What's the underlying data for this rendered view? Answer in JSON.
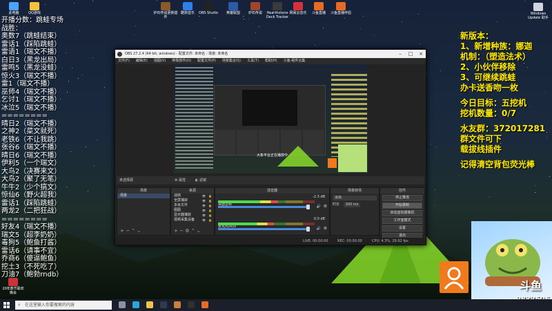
{
  "desktop": {
    "icons": [
      {
        "label": "此电脑",
        "color": "#4aa3ff"
      },
      {
        "label": "QQ游戏",
        "color": "#f5c33b"
      },
      {
        "label": "炉石传说更新插件",
        "color": "#8a5a2b"
      },
      {
        "label": "酷狗音乐",
        "color": "#2e7fe8"
      },
      {
        "label": "OBS Studio",
        "color": "#222222"
      },
      {
        "label": "英雄联盟",
        "color": "#2b5aa8"
      },
      {
        "label": "炉石传说",
        "color": "#a0442c"
      },
      {
        "label": "Hearthstone Deck Tracker",
        "color": "#3a3a3a"
      },
      {
        "label": "网易云音乐",
        "color": "#d8303a"
      },
      {
        "label": "斗鱼直播",
        "color": "#e86a25"
      },
      {
        "label": "斗鱼直播伴侣",
        "color": "#e86a25"
      },
      {
        "label": "Windows Update 助手",
        "color": "#cfd6e0"
      }
    ],
    "bottom_icon_label": "20年春节联欢晚会"
  },
  "left_overlay": {
    "header": "开播分数：跳蛙专场",
    "lines": [
      "战胜：",
      "奥数7（跳蛙结束）",
      "雷话1（踩陷跳蛙）",
      "雷语1（瑞文不播）",
      "白日3（黑龙出局）",
      "雷鸣5（黑龙没蛙）",
      "惊火3（瑞文不播）",
      "雷1（瑞文不播）",
      "巫师4（瑞文不播）",
      "乞讨1（瑞文不播）",
      "冰泣5（瑞文不播）",
      "========",
      "晴日2（瑞文不播）",
      "之神2（菜文就死）",
      "老铁6（不让我跳）",
      "张谷6（瑞文不播）",
      "晴日6（瑞文不播）",
      "伊利5（一个瑞文）",
      "大鸟2（决赛来文）",
      "大鸟2（聚了无笔）",
      "牛牛2（少个搞文）",
      "惊仙6（野火超我）",
      "雷话1（踩陷跳蛙）",
      "两龙2（二把狂战）",
      "========",
      "好友4（瑞文不播）",
      "瑞文5（超李奶奶）",
      "毒狗5（鲍鱼打酱）",
      "雷话6（请事不宜）",
      "乔商6（傻逼鲍鱼）",
      "挖土3（不死吃了）",
      "刀油7（鲍勃rndb）"
    ]
  },
  "right_overlay": {
    "lines": [
      "新版本：",
      "1、新增种族：娜迦",
      "机制：（塑造法术）",
      "2、小伙伴移除",
      "3、可继续跳蛙",
      "办卡送香吻一枚",
      "",
      "今日目标：五挖机",
      "挖机数量：0/7",
      "",
      "水友群：372017281",
      "群文件可下",
      "载拔线插件",
      "",
      "记得清空背包荧光棒"
    ]
  },
  "obs": {
    "title": "OBS 27.2.4 (64-bit, windows) - 配置文件: 未命名 - 场景: 未命名",
    "menu": [
      "文件(F)",
      "编辑(E)",
      "视图(V)",
      "停靠部件(D)",
      "配置文件(P)",
      "场景集合(S)",
      "工具(T)",
      "帮助(H)",
      "斗鱼-组件合集"
    ],
    "preview_caption": "大象平台正在播放中",
    "scene_label": "未选择源",
    "tabs": [
      "属性",
      "滤镜"
    ],
    "docks": {
      "scenes": {
        "title": "场景",
        "items": [
          "场景"
        ]
      },
      "sources": {
        "title": "来源",
        "items": [
          "战绩",
          "全屏捕获",
          "多余文件",
          "图图",
          "显示器捕获",
          "视频采集设备"
        ]
      },
      "mixer": {
        "title": "混音器",
        "channels": [
          {
            "name": "桌面音频",
            "db": "-2.3 dB",
            "level": 0.62
          },
          {
            "name": "麦克风/Aux",
            "db": "0.0 dB",
            "level": 0.58
          }
        ]
      },
      "transitions": {
        "title": "场景转场",
        "type": "淡出",
        "duration_label": "时长",
        "duration": "300 ms"
      },
      "controls": {
        "title": "控件",
        "buttons": [
          "停止推流",
          "开始录制",
          "启动虚拟摄像机",
          "工作室模式",
          "设置",
          "退出"
        ]
      }
    },
    "status": {
      "live": "LIVE: 00:00:00",
      "rec": "REC: 00:00:00",
      "cpu": "CPU: 4.3%, 29.92 fps"
    }
  },
  "douyu": {
    "logo": "斗鱼",
    "room_id": "9832506"
  },
  "taskbar": {
    "search_placeholder": "在这里输入你要搜索的内容",
    "icons": [
      "task-view",
      "edge",
      "file-explorer",
      "obs",
      "hearthstone",
      "obs-studio",
      "douyu"
    ]
  }
}
